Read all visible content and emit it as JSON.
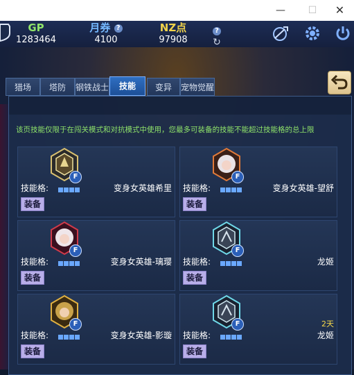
{
  "window": {
    "minimize_glyph": "—",
    "maximize_glyph": "☐",
    "close_glyph": "✕"
  },
  "resources": {
    "gp": {
      "label": "GP",
      "value": "1283464"
    },
    "voucher": {
      "label": "月券",
      "value": "4100",
      "help": "?"
    },
    "nz": {
      "label": "NZ点",
      "value": "97908"
    },
    "help": "?",
    "refresh": "↻"
  },
  "tabs": [
    {
      "label": "猎场"
    },
    {
      "label": "塔防"
    },
    {
      "label": "钢铁战士"
    },
    {
      "label": "技能"
    },
    {
      "label": "变异"
    },
    {
      "label": "宠物觉醒"
    }
  ],
  "active_tab": "技能",
  "notice": "该页技能仅限于在闯关模式和对抗模式中使用，您最多可装备的技能不能超过技能格的总上限",
  "slot_label": "技能格:",
  "equip_label": "装备",
  "badge_letter": "F",
  "cards": [
    {
      "name": "变身女英雄希里",
      "icon": "hero-emblem-icon",
      "slots": 4
    },
    {
      "name": "变身女英雄-望舒",
      "icon": "hero-portrait-icon",
      "slots": 4
    },
    {
      "name": "变身女英雄-璃璎",
      "icon": "hero-portrait-icon",
      "slots": 4
    },
    {
      "name": "龙姬",
      "icon": "dragon-emblem-icon",
      "slots": 4
    },
    {
      "name": "变身女英雄-影璇",
      "icon": "hero-portrait-icon",
      "slots": 4
    },
    {
      "name": "龙姬",
      "icon": "dragon-emblem-icon",
      "slots": 4,
      "days": "2天"
    }
  ],
  "colors": {
    "gp": "#8fe36a",
    "voucher": "#74b8ff",
    "nz": "#f0d24a",
    "notice": "#8fe36a",
    "active_tab": "#2f6fc2",
    "equip": "#b8aee8"
  }
}
